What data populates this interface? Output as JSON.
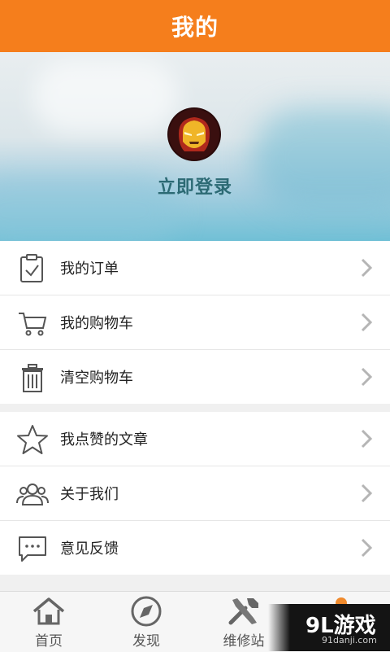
{
  "header": {
    "title": "我的"
  },
  "profile": {
    "login_label": "立即登录"
  },
  "menu_group_1": [
    {
      "label": "我的订单",
      "icon": "clipboard-check-icon"
    },
    {
      "label": "我的购物车",
      "icon": "cart-icon"
    },
    {
      "label": "清空购物车",
      "icon": "trash-icon"
    }
  ],
  "menu_group_2": [
    {
      "label": "我点赞的文章",
      "icon": "star-icon"
    },
    {
      "label": "关于我们",
      "icon": "users-icon"
    },
    {
      "label": "意见反馈",
      "icon": "chat-bubble-icon"
    }
  ],
  "tabs": [
    {
      "label": "首页",
      "icon": "home-icon"
    },
    {
      "label": "发现",
      "icon": "compass-icon"
    },
    {
      "label": "维修站",
      "icon": "tools-icon"
    }
  ],
  "watermark": {
    "text": "9L游戏",
    "sub": "91danji.com"
  },
  "colors": {
    "brand": "#f57e1c",
    "login_text": "#2c6a74"
  }
}
